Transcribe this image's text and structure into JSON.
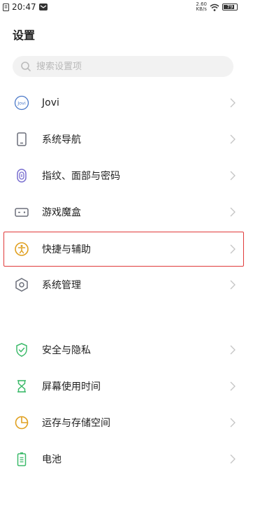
{
  "status": {
    "time": "20:47",
    "net_speed_top": "2.60",
    "net_speed_bottom": "KB/s",
    "battery": "79"
  },
  "page_title": "设置",
  "search": {
    "placeholder": "搜索设置项"
  },
  "items": [
    {
      "label": "Jovi",
      "icon": "jovi-icon"
    },
    {
      "label": "系统导航",
      "icon": "phone-navigation-icon"
    },
    {
      "label": "指纹、面部与密码",
      "icon": "fingerprint-icon"
    },
    {
      "label": "游戏魔盒",
      "icon": "game-box-icon"
    },
    {
      "label": "快捷与辅助",
      "icon": "accessibility-icon"
    },
    {
      "label": "系统管理",
      "icon": "system-management-icon"
    },
    {
      "label": "安全与隐私",
      "icon": "shield-icon"
    },
    {
      "label": "屏幕使用时间",
      "icon": "hourglass-icon"
    },
    {
      "label": "运存与存储空间",
      "icon": "storage-pie-icon"
    },
    {
      "label": "电池",
      "icon": "battery-icon"
    }
  ],
  "colors": {
    "highlight": "#e03a3a",
    "icon_gray": "#6b6f7a",
    "icon_purple": "#7a6fd0",
    "icon_orange": "#e0a020",
    "icon_green": "#3cba6a"
  }
}
